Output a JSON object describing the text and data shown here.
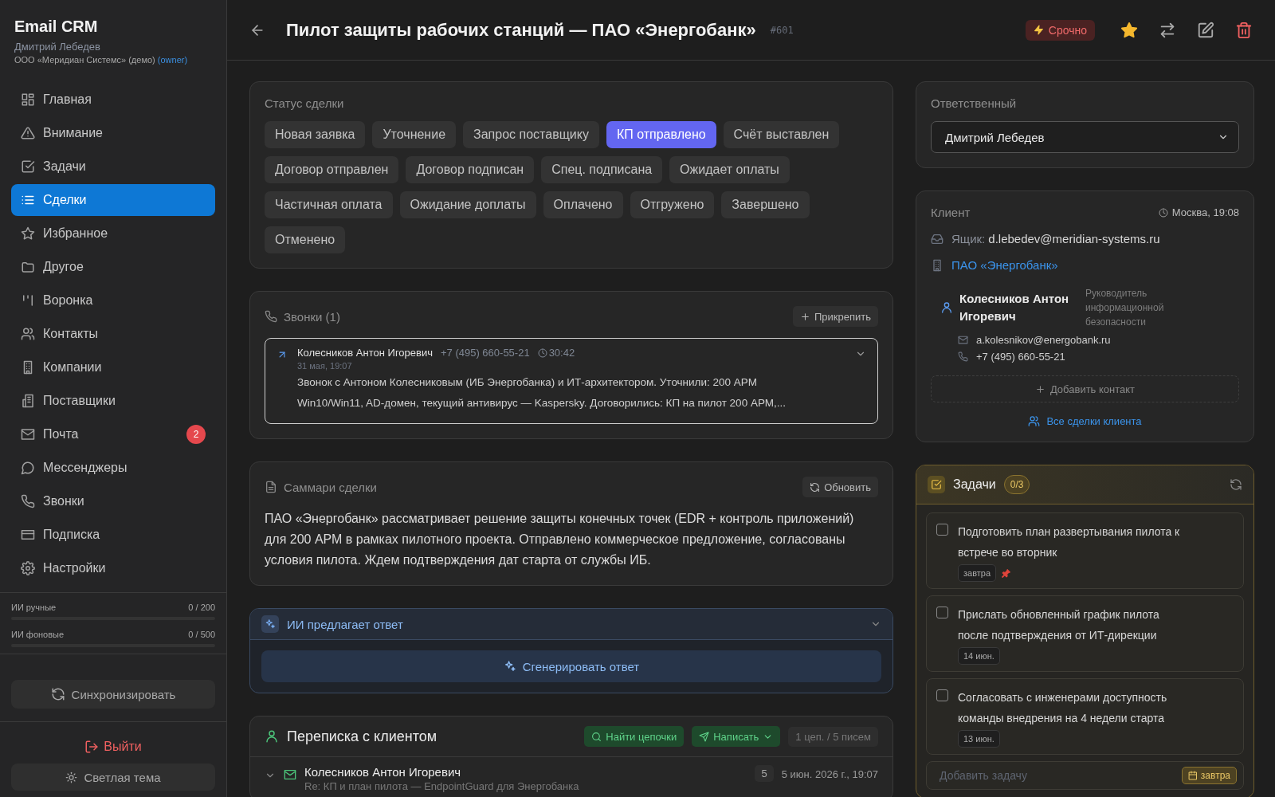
{
  "sidebar": {
    "app_title": "Email CRM",
    "user_name": "Дмитрий Лебедев",
    "org": "ООО «Меридиан Системс» (демо)",
    "role": "(owner)",
    "items": [
      {
        "label": "Главная",
        "selected": false
      },
      {
        "label": "Внимание",
        "selected": false
      },
      {
        "label": "Задачи",
        "selected": false
      },
      {
        "label": "Сделки",
        "selected": true
      },
      {
        "label": "Избранное",
        "selected": false
      },
      {
        "label": "Другое",
        "selected": false
      },
      {
        "label": "Воронка",
        "selected": false
      },
      {
        "label": "Контакты",
        "selected": false
      },
      {
        "label": "Компании",
        "selected": false
      },
      {
        "label": "Поставщики",
        "selected": false
      },
      {
        "label": "Почта",
        "selected": false,
        "badge": "2"
      },
      {
        "label": "Мессенджеры",
        "selected": false
      },
      {
        "label": "Звонки",
        "selected": false
      },
      {
        "label": "Подписка",
        "selected": false
      },
      {
        "label": "Настройки",
        "selected": false
      }
    ],
    "usage": [
      {
        "label": "ИИ ручные",
        "reading": "0 / 200",
        "level": 0
      },
      {
        "label": "ИИ фоновые",
        "reading": "0 / 500",
        "level": 0
      }
    ],
    "sync_button": "Синхронизировать",
    "logout_button": "Выйти",
    "theme_button": "Светлая тема"
  },
  "header": {
    "title": "Пилот защиты рабочих станций — ПАО «Энергобанк»",
    "number": "#601",
    "urgent_badge": "Срочно",
    "favorite": true
  },
  "status": {
    "label": "Статус сделки",
    "options": [
      {
        "label": "Новая заявка",
        "selected": false
      },
      {
        "label": "Уточнение",
        "selected": false
      },
      {
        "label": "Запрос поставщику",
        "selected": false
      },
      {
        "label": "КП отправлено",
        "selected": true
      },
      {
        "label": "Счёт выставлен",
        "selected": false
      },
      {
        "label": "Договор отправлен",
        "selected": false
      },
      {
        "label": "Договор подписан",
        "selected": false
      },
      {
        "label": "Спец. подписана",
        "selected": false
      },
      {
        "label": "Ожидает оплаты",
        "selected": false
      },
      {
        "label": "Частичная оплата",
        "selected": false
      },
      {
        "label": "Ожидание доплаты",
        "selected": false
      },
      {
        "label": "Оплачено",
        "selected": false
      },
      {
        "label": "Отгружено",
        "selected": false
      },
      {
        "label": "Завершено",
        "selected": false
      },
      {
        "label": "Отменено",
        "selected": false
      }
    ]
  },
  "calls": {
    "title": "Звонки (1)",
    "attach_button": "Прикрепить",
    "items": [
      {
        "name": "Колесников Антон Игоревич",
        "phone": "+7 (495) 660-55-21",
        "duration": "30:42",
        "date": "31 мая, 19:07",
        "summary": "Звонок с Антоном Колесниковым (ИБ Энергобанка) и ИТ-архитектором. Уточнили: 200 АРМ Win10/Win11, AD-домен, текущий антивирус — Kaspersky. Договорились: КП на пилот 200 АРМ,..."
      }
    ]
  },
  "summary": {
    "title": "Саммари сделки",
    "refresh_button": "Обновить",
    "text": "ПАО «Энергобанк» рассматривает решение защиты конечных точек (EDR + контроль приложений) для 200 АРМ в рамках пилотного проекта. Отправлено коммерческое предложение, согласованы условия пилота. Ждем подтверждения дат старта от службы ИБ."
  },
  "ai": {
    "title": "ИИ предлагает ответ",
    "generate_button": "Сгенерировать ответ"
  },
  "correspondence": {
    "title": "Переписка с клиентом",
    "find_button": "Найти цепочки",
    "write_button": "Написать",
    "stats": "1 цеп. / 5 писем",
    "threads": [
      {
        "name": "Колесников Антон Игоревич",
        "subject": "Re: КП и план пилота — EndpointGuard для Энергобанка",
        "count": "5",
        "date": "5 июн. 2026 г., 19:07"
      }
    ]
  },
  "responsible": {
    "label": "Ответственный",
    "value": "Дмитрий Лебедев"
  },
  "client": {
    "label": "Клиент",
    "local_time": "Москва, 19:08",
    "mailbox_label": "Ящик:",
    "mailbox": "d.lebedev@meridian-systems.ru",
    "company": "ПАО «Энергобанк»",
    "contacts": [
      {
        "name": "Колесников Антон Игоревич",
        "role": "Руководитель информационной безопасности",
        "email": "a.kolesnikov@energobank.ru",
        "phone": "+7 (495) 660-55-21"
      }
    ],
    "add_contact": "Добавить контакт",
    "all_deals": "Все сделки клиента"
  },
  "tasks": {
    "title": "Задачи",
    "count": "0/3",
    "items": [
      {
        "text": "Подготовить план развертывания пилота к встрече во вторник",
        "due": "завтра",
        "checked": false,
        "pinned": true
      },
      {
        "text": "Прислать обновленный график пилота после подтверждения от ИТ-дирекции",
        "due": "14 июн.",
        "checked": false,
        "pinned": false
      },
      {
        "text": "Согласовать с инженерами доступность команды внедрения на 4 недели старта",
        "due": "13 июн.",
        "checked": false,
        "pinned": false
      }
    ],
    "new_task": {
      "placeholder": "Добавить задачу",
      "due": "завтра"
    }
  }
}
